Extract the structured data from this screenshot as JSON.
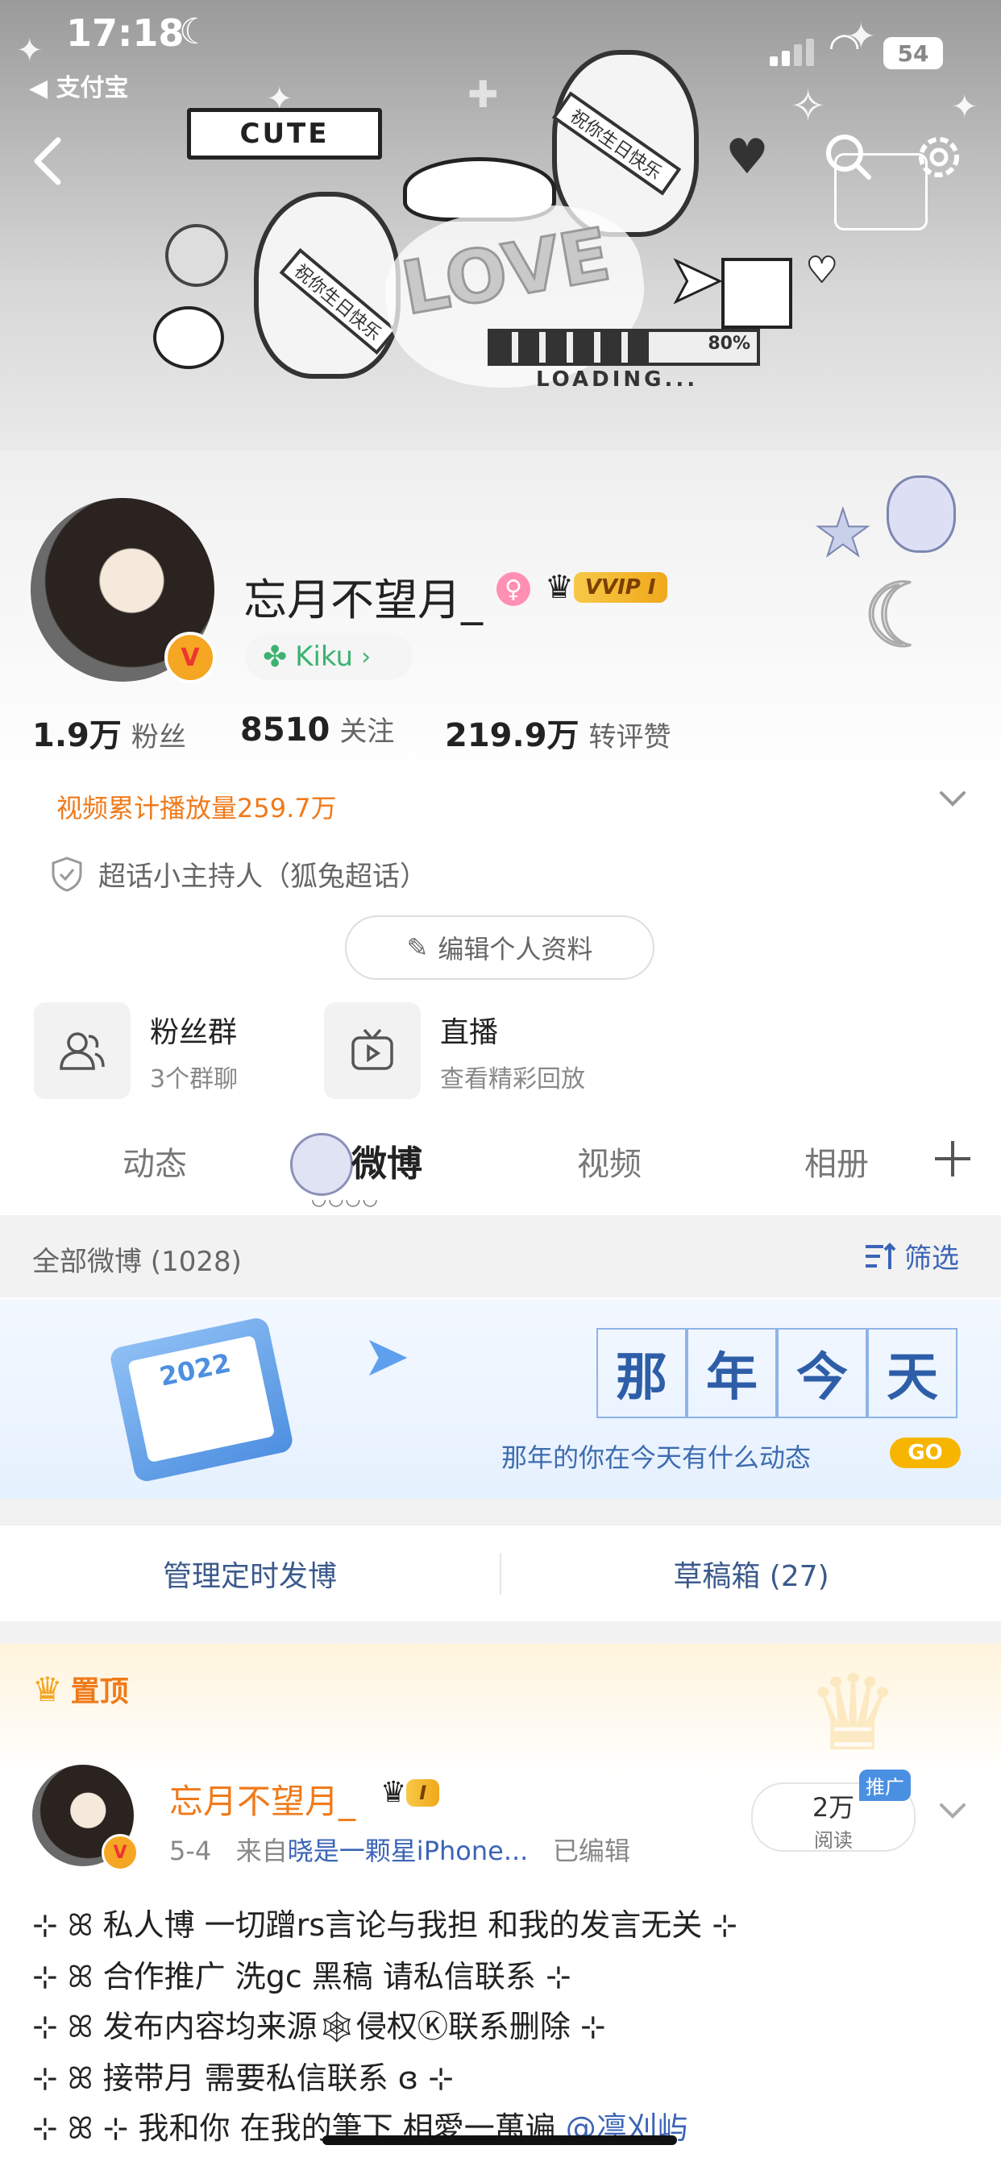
{
  "status_bar": {
    "time": "17:18",
    "back_app": "◀ 支付宝",
    "battery": "54"
  },
  "profile": {
    "name": "忘月不望月_",
    "vip_label": "VVIP I",
    "kiku_label": "Kiku",
    "stats": [
      {
        "value": "1.9万",
        "label": "粉丝"
      },
      {
        "value": "8510",
        "label": "关注"
      },
      {
        "value": "219.9万",
        "label": "转评赞"
      }
    ],
    "video_plays": "视频累计播放量259.7万",
    "host_title": "超话小主持人（狐兔超话）",
    "edit_button": "编辑个人资料"
  },
  "tiles": [
    {
      "title": "粉丝群",
      "subtitle": "3个群聊"
    },
    {
      "title": "直播",
      "subtitle": "查看精彩回放"
    }
  ],
  "tabs": [
    "动态",
    "微博",
    "视频",
    "相册"
  ],
  "filter": {
    "label": "全部微博 (1028)",
    "button": "筛选"
  },
  "memory_banner": {
    "chars": [
      "那",
      "年",
      "今",
      "天"
    ],
    "subtitle": "那年的你在今天有什么动态",
    "go": "GO"
  },
  "actions": {
    "scheduled": "管理定时发博",
    "drafts": "草稿箱 (27)"
  },
  "pinned": {
    "label": "置顶",
    "author": "忘月不望月_",
    "vip_label": "I",
    "date": "5-4",
    "from_prefix": "来自",
    "source": "晓是一颗星iPhone...",
    "edited": "已编辑",
    "reads_num": "2万",
    "reads_label": "阅读",
    "promo": "推广",
    "lines": [
      {
        "text": "⊹ ꕤ 私人博 一切蹭rs言论与我担 和我的发言无关 ⊹"
      },
      {
        "text": "⊹ ꕤ 合作推广 洗gc 黑稿 请私信联系 ⊹"
      },
      {
        "text": "⊹ ꕤ 发布内容均来源🕸侵权Ⓚ联系删除 ⊹"
      },
      {
        "text": "⊹ ꕤ 接带月 需要私信联系 ɞ ⊹"
      },
      {
        "text": "⊹ ꕤ ⊹ 我和你 在我的筆下 相愛一萬遍 ",
        "mention": "@凛刈屿"
      }
    ]
  },
  "banner_text": {
    "cute": "CUTE",
    "love": "LOVE",
    "loading": "LOADING...",
    "percent": "80%"
  }
}
